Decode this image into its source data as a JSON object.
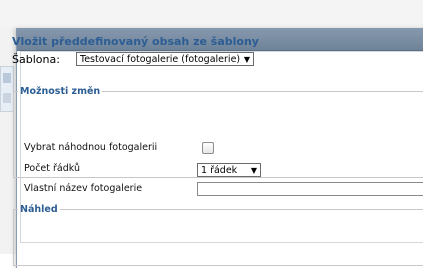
{
  "dialog": {
    "heading": "Vložit předdefinovaný obsah ze šablony",
    "template_label": "Šablona:",
    "template_value": "Testovací fotogalerie (fotogalerie)",
    "changes_legend": "Možnosti změn",
    "random_gallery_label": "Vybrat náhodnou fotogalerii",
    "random_gallery_checked": false,
    "row_count_label": "Počet řádků",
    "row_count_value": "1 řádek",
    "custom_name_label": "Vlastní název fotogalerie",
    "custom_name_value": "",
    "preview_legend": "Náhled"
  },
  "icons": {
    "dropdown": "▼"
  }
}
